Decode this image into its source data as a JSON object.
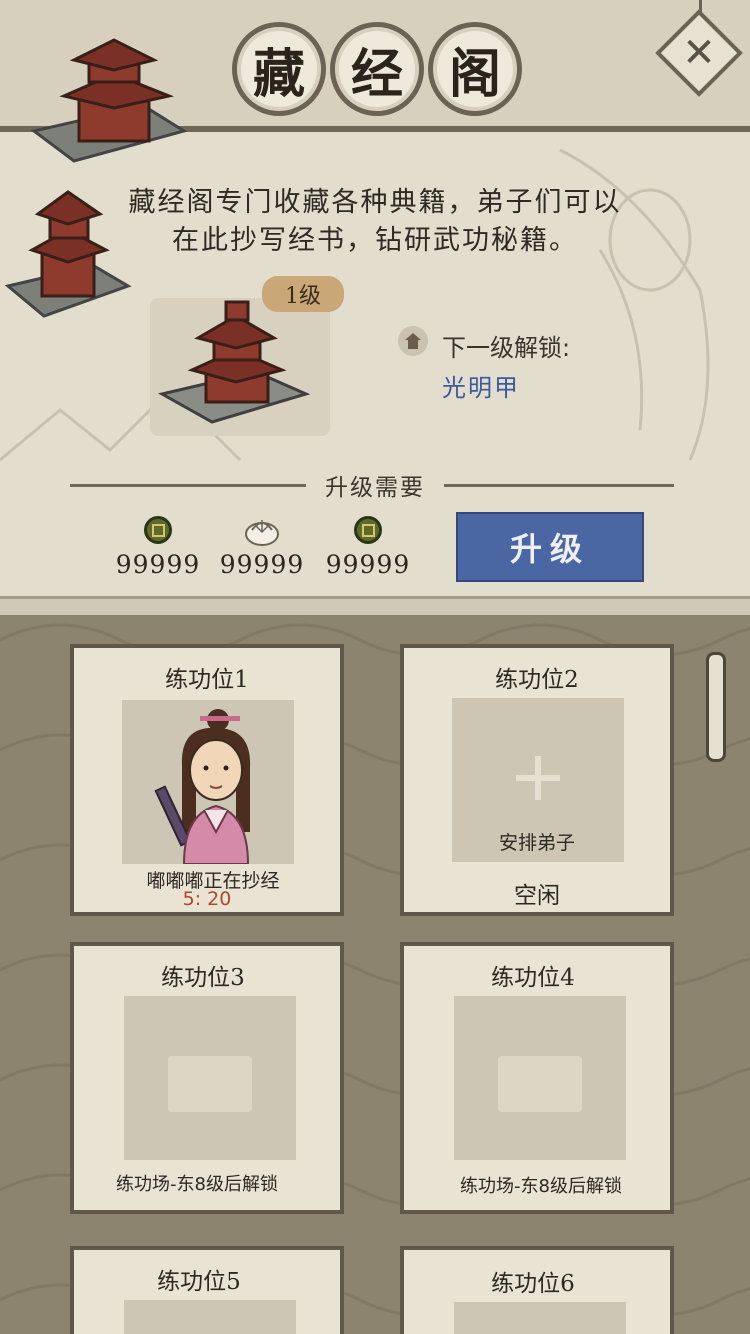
{
  "title": {
    "chars": [
      "藏",
      "经",
      "阁"
    ]
  },
  "description": {
    "line1": "藏经阁专门收藏各种典籍，弟子们可以",
    "line2": "在此抄写经书，钻研武功秘籍。"
  },
  "building": {
    "level": "1级"
  },
  "unlock": {
    "label": "下一级解锁:",
    "item": "光明甲"
  },
  "requirements": {
    "title": "升级需要",
    "items": [
      {
        "icon": "copper-coin-icon",
        "amount": "99999"
      },
      {
        "icon": "bun-icon",
        "amount": "99999"
      },
      {
        "icon": "copper-coin-icon",
        "amount": "99999"
      }
    ]
  },
  "upgrade_label": "升级",
  "close_icon": "✕",
  "slots": [
    {
      "title": "练功位1",
      "status": "嘟嘟嘟正在抄经",
      "timer": "5: 20"
    },
    {
      "title": "练功位2",
      "action": "安排弟子",
      "status": "空闲"
    },
    {
      "title": "练功位3",
      "status": "练功场-东8级后解锁"
    },
    {
      "title": "练功位4",
      "status": "练功场-东8级后解锁"
    },
    {
      "title": "练功位5"
    },
    {
      "title": "练功位6"
    }
  ],
  "colors": {
    "accent_blue": "#4a67a3",
    "timer_red": "#b0472d",
    "parchment": "#e8e3d3"
  }
}
